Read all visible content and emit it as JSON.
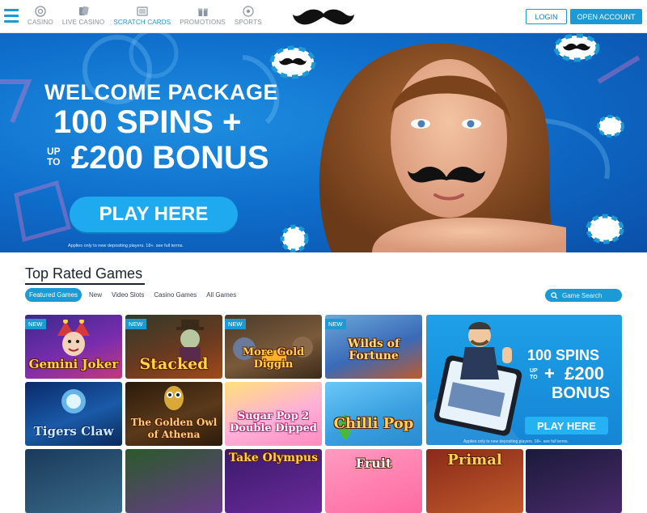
{
  "header": {
    "nav": [
      {
        "label": "CASINO",
        "icon": "casino-chip-icon"
      },
      {
        "label": "LIVE CASINO",
        "icon": "cards-icon"
      },
      {
        "label": "SCRATCH CARDS",
        "icon": "scratch-card-icon"
      },
      {
        "label": "PROMOTIONS",
        "icon": "gift-icon"
      },
      {
        "label": "SPORTS",
        "icon": "soccer-ball-icon"
      }
    ],
    "active_nav": "SCRATCH CARDS",
    "logo_icon": "moustache-logo-icon",
    "login_label": "LOGIN",
    "open_account_label": "OPEN ACCOUNT"
  },
  "hero": {
    "line1": "WELCOME PACKAGE",
    "line2": "100 SPINS +",
    "upto": "UP TO",
    "line3": "£200 BONUS",
    "cta": "PLAY HERE",
    "terms": "Applies only to new depositing players. 18+. see full terms."
  },
  "games": {
    "title": "Top Rated Games",
    "tabs": [
      "Featured Games",
      "New",
      "Video Slots",
      "Casino Games",
      "All Games"
    ],
    "active_tab": "Featured Games",
    "search_placeholder": "Game Search",
    "tiles": [
      {
        "name": "Gemini Joker",
        "badge": "NEW"
      },
      {
        "name": "Stacked",
        "badge": "NEW"
      },
      {
        "name": "More Gold Diggin",
        "badge": "NEW"
      },
      {
        "name": "Wilds of Fortune",
        "badge": "NEW"
      },
      {
        "name": "Tigers Claw",
        "badge": ""
      },
      {
        "name": "The Golden Owl of Athena",
        "badge": ""
      },
      {
        "name": "Sugar Pop 2 Double Dipped",
        "badge": ""
      },
      {
        "name": "Chilli Pop",
        "badge": ""
      },
      {
        "name": "",
        "badge": ""
      },
      {
        "name": "",
        "badge": ""
      },
      {
        "name": "Take Olympus",
        "badge": ""
      },
      {
        "name": "Fruit",
        "badge": ""
      },
      {
        "name": "Primal",
        "badge": ""
      },
      {
        "name": "",
        "badge": ""
      }
    ]
  },
  "promo": {
    "line1": "100 SPINS",
    "plus": "+",
    "upto": "UP TO",
    "amount": "£200",
    "line3": "BONUS",
    "cta": "PLAY HERE",
    "terms": "Applies only to new depositing players. 18+. see full terms."
  },
  "colors": {
    "accent": "#1b9ad6",
    "hero_bg": "#0f6fcc"
  }
}
